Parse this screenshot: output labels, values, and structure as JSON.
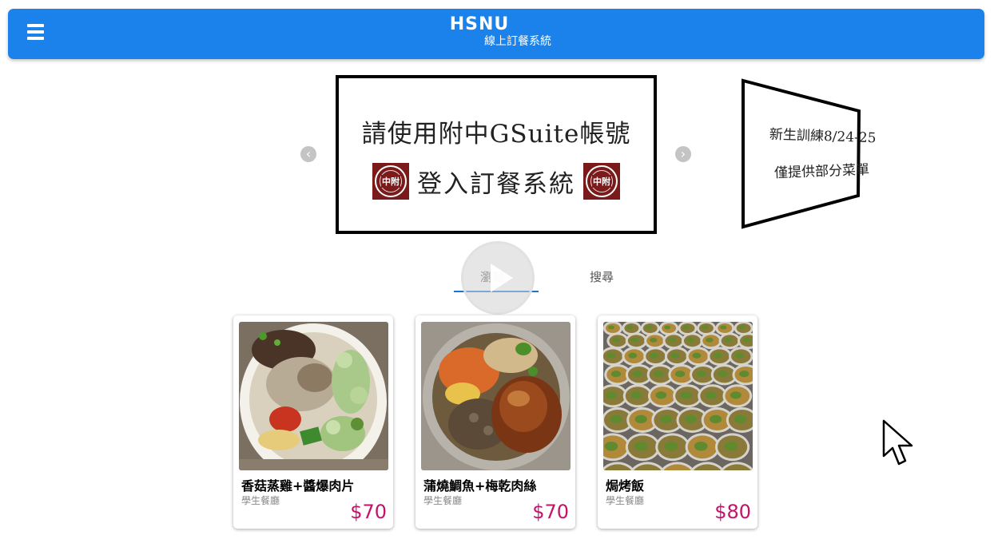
{
  "header": {
    "title": "HSNU",
    "subtitle": "線上訂餐系統",
    "menu_icon": "hamburger-menu-icon",
    "color": "#1a82ea"
  },
  "carousel": {
    "main_slide": {
      "line1": "請使用附中GSuite帳號",
      "line2": "登入訂餐系統",
      "emblem_text": "中附",
      "emblem_color": "#7a1a1a"
    },
    "side_slide": {
      "line1": "新生訓練8/24-25",
      "line2": "僅提供部分菜單"
    },
    "prev_icon": "chevron-left-icon",
    "next_icon": "chevron-right-icon"
  },
  "tabs": {
    "browse": "瀏覽",
    "search": "搜尋",
    "active": "browse",
    "accent_color": "#1a74d6"
  },
  "overlay": {
    "icon": "play-icon"
  },
  "menu_items": [
    {
      "name": "香菇蒸雞+醬爆肉片",
      "place": "學生餐廳",
      "price": "$70"
    },
    {
      "name": "蒲燒鯛魚+梅乾肉絲",
      "place": "學生餐廳",
      "price": "$70"
    },
    {
      "name": "焗烤飯",
      "place": "學生餐廳",
      "price": "$80"
    }
  ],
  "price_color": "#c2136a"
}
